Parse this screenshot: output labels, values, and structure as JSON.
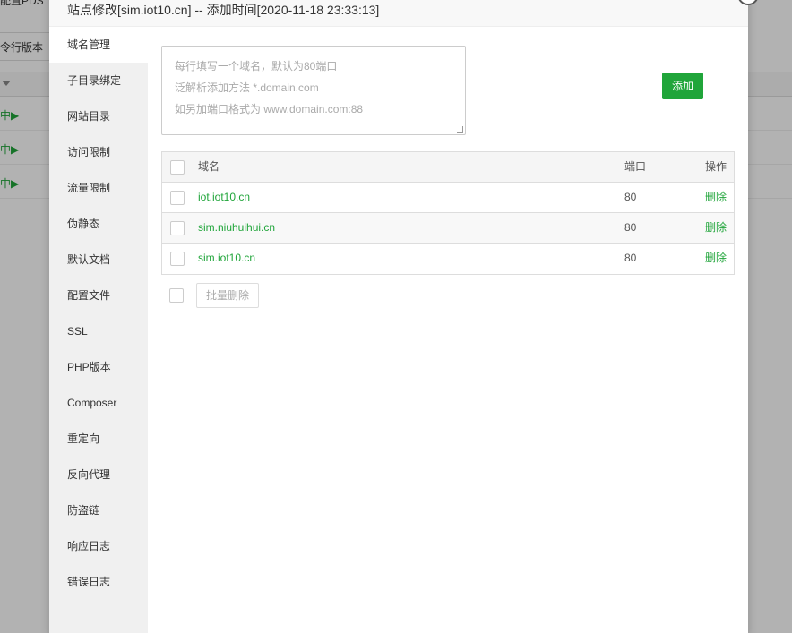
{
  "background": {
    "top_text": "配置PDS",
    "tab_label": "令行版本",
    "rows": [
      {
        "status": "中▶"
      },
      {
        "status": "中▶"
      },
      {
        "status": "中▶"
      }
    ]
  },
  "modal": {
    "title": "站点修改[sim.iot10.cn] -- 添加时间[2020-11-18 23:33:13]",
    "sidebar": [
      {
        "label": "域名管理"
      },
      {
        "label": "子目录绑定"
      },
      {
        "label": "网站目录"
      },
      {
        "label": "访问限制"
      },
      {
        "label": "流量限制"
      },
      {
        "label": "伪静态"
      },
      {
        "label": "默认文档"
      },
      {
        "label": "配置文件"
      },
      {
        "label": "SSL"
      },
      {
        "label": "PHP版本"
      },
      {
        "label": "Composer"
      },
      {
        "label": "重定向"
      },
      {
        "label": "反向代理"
      },
      {
        "label": "防盗链"
      },
      {
        "label": "响应日志"
      },
      {
        "label": "错误日志"
      }
    ],
    "textarea_placeholder_lines": [
      "每行填写一个域名，默认为80端口",
      "泛解析添加方法 *.domain.com",
      "如另加端口格式为 www.domain.com:88"
    ],
    "add_button": "添加",
    "table": {
      "headers": {
        "domain": "域名",
        "port": "端口",
        "op": "操作"
      },
      "rows": [
        {
          "domain": "iot.iot10.cn",
          "port": "80",
          "op": "删除"
        },
        {
          "domain": "sim.niuhuihui.cn",
          "port": "80",
          "op": "删除"
        },
        {
          "domain": "sim.iot10.cn",
          "port": "80",
          "op": "删除"
        }
      ]
    },
    "batch_delete": "批量删除"
  },
  "colors": {
    "accent": "#20a53a"
  }
}
